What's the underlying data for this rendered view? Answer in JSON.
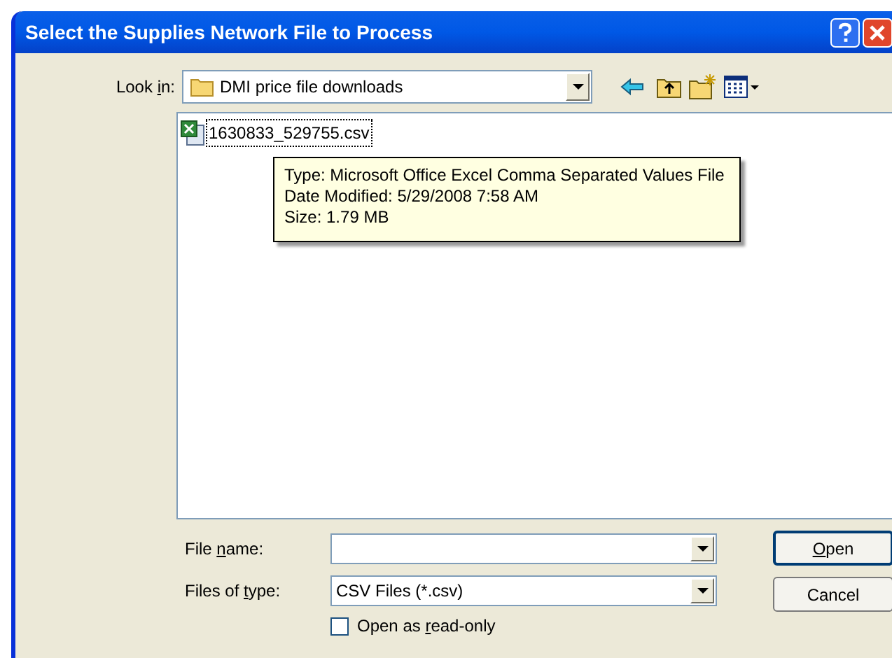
{
  "window": {
    "title": "Select the Supplies Network File to Process"
  },
  "look_in": {
    "label": {
      "before": "Look ",
      "key": "i",
      "after": "n:"
    },
    "value": "DMI price file downloads"
  },
  "files": [
    {
      "name": "1630833_529755.csv",
      "focused": true
    }
  ],
  "tooltip": {
    "lines": [
      "Type: Microsoft Office Excel Comma Separated Values File",
      "Date Modified: 5/29/2008 7:58 AM",
      "Size: 1.79 MB"
    ]
  },
  "file_name": {
    "label": {
      "before": "File ",
      "key": "n",
      "after": "ame:"
    }
  },
  "file_type": {
    "label": {
      "before": "Files of ",
      "key": "t",
      "after": "ype:"
    },
    "value": "CSV Files (*.csv)"
  },
  "read_only": {
    "label": {
      "before": "Open as ",
      "key": "r",
      "after": "ead-only"
    },
    "checked": false
  },
  "buttons": [
    {
      "label": {
        "key": "O",
        "after": "pen"
      },
      "default": true
    },
    {
      "label": {
        "before": "Cancel"
      },
      "default": false
    }
  ]
}
